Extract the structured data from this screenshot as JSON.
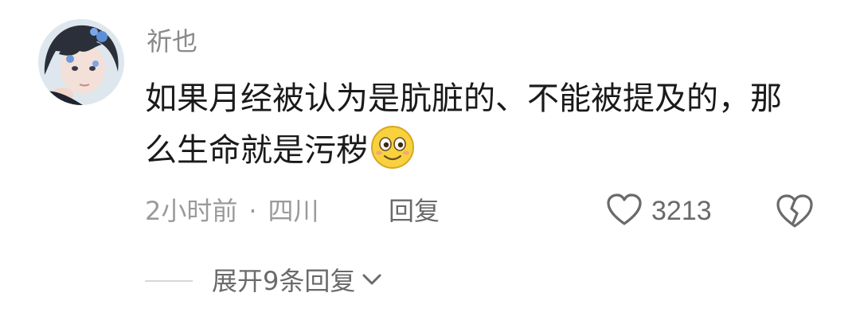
{
  "comment": {
    "username": "祈也",
    "text": "如果月经被认为是肮脏的、不能被提及的，那么生命就是污秽",
    "emoji_icon": "smiling-face-emoji-icon",
    "time": "2小时前",
    "separator": "·",
    "location": "四川",
    "reply_label": "回复",
    "like_count": "3213",
    "expand_label": "展开9条回复"
  },
  "colors": {
    "username": "#8a8a8a",
    "text": "#1a1a1a",
    "meta": "#9a9a9a",
    "action": "#6a6a6a",
    "divider": "#d7d7d7",
    "emoji_yellow": "#f7d23e"
  },
  "icons": {
    "like": "heart-outline-icon",
    "dislike": "broken-heart-icon",
    "expand": "chevron-down-icon"
  }
}
